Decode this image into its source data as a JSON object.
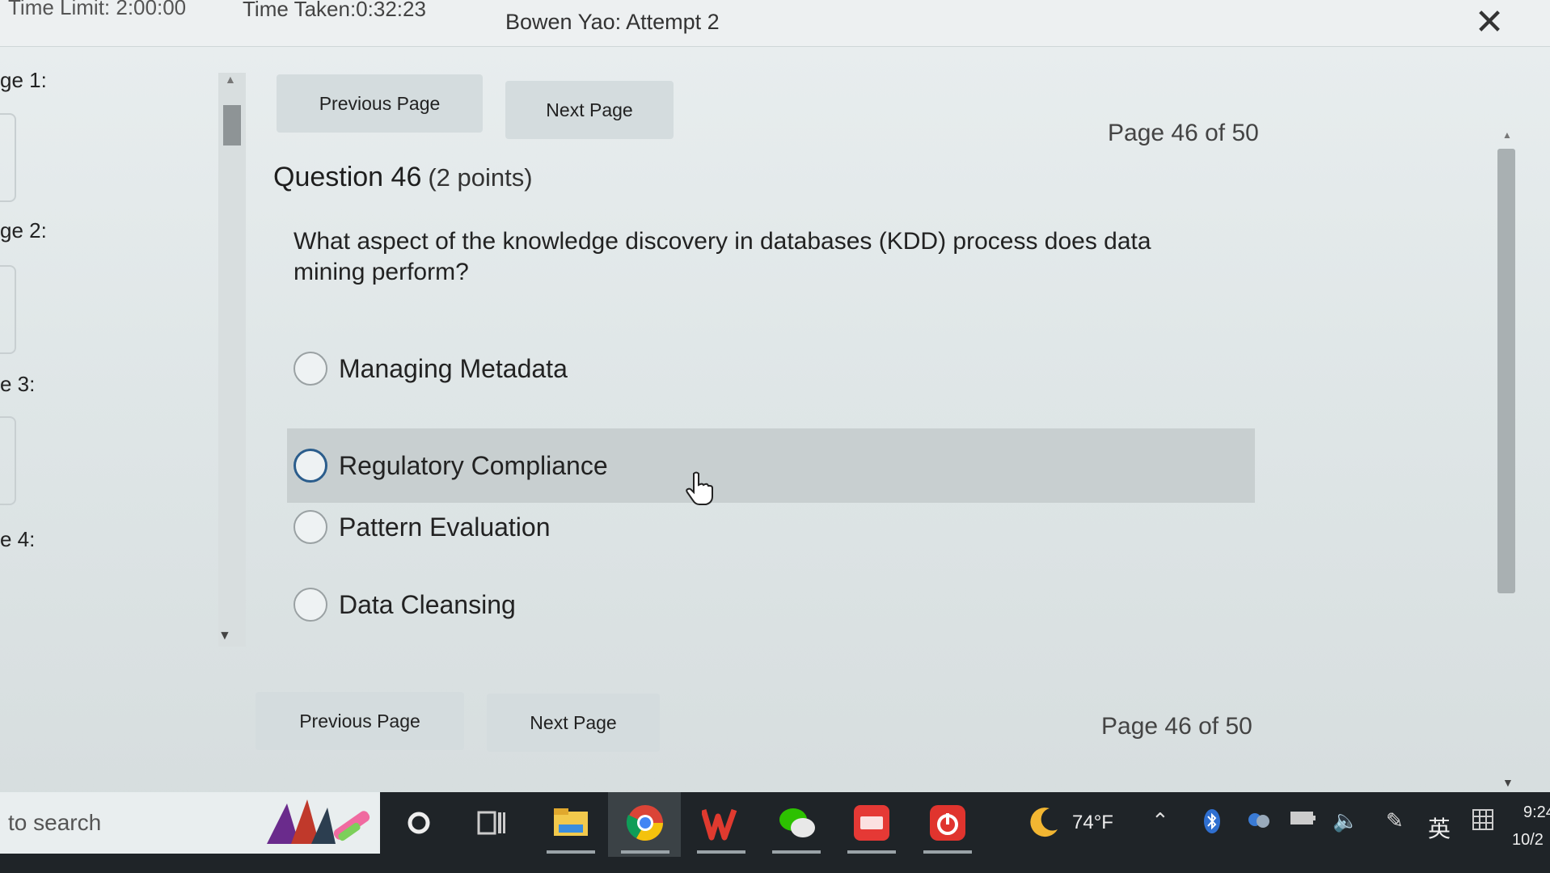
{
  "header": {
    "time_limit": "Time Limit: 2:00:00",
    "time_taken": "Time Taken:0:32:23",
    "attempt": "Bowen Yao: Attempt 2",
    "close_symbol": "✕"
  },
  "left_nav": {
    "items": [
      {
        "label": "ge 1:"
      },
      {
        "label": "ge 2:"
      },
      {
        "label": "e 3:"
      },
      {
        "label": "e 4:"
      }
    ]
  },
  "nav_top": {
    "previous_label": "Previous Page",
    "next_label": "Next Page",
    "page_indicator": "Page 46 of 50"
  },
  "question": {
    "title": "Question 46",
    "points": "(2 points)",
    "text": "What aspect of the knowledge discovery in databases (KDD) process does data mining perform?",
    "options": [
      {
        "label": "Managing Metadata"
      },
      {
        "label": "Regulatory Compliance"
      },
      {
        "label": "Pattern Evaluation"
      },
      {
        "label": "Data Cleansing"
      }
    ]
  },
  "nav_bottom": {
    "previous_label": "Previous Page",
    "next_label": "Next Page",
    "page_indicator": "Page 46 of 50"
  },
  "taskbar": {
    "search_placeholder": "to search",
    "weather": "74°F",
    "ime": "英",
    "time": "9:24",
    "date": "10/2"
  },
  "colors": {
    "button_bg": "#d4dcde",
    "hover_row": "#c8cfd0",
    "focus_ring": "#2b5d8c",
    "taskbar_bg": "#1f2428"
  }
}
